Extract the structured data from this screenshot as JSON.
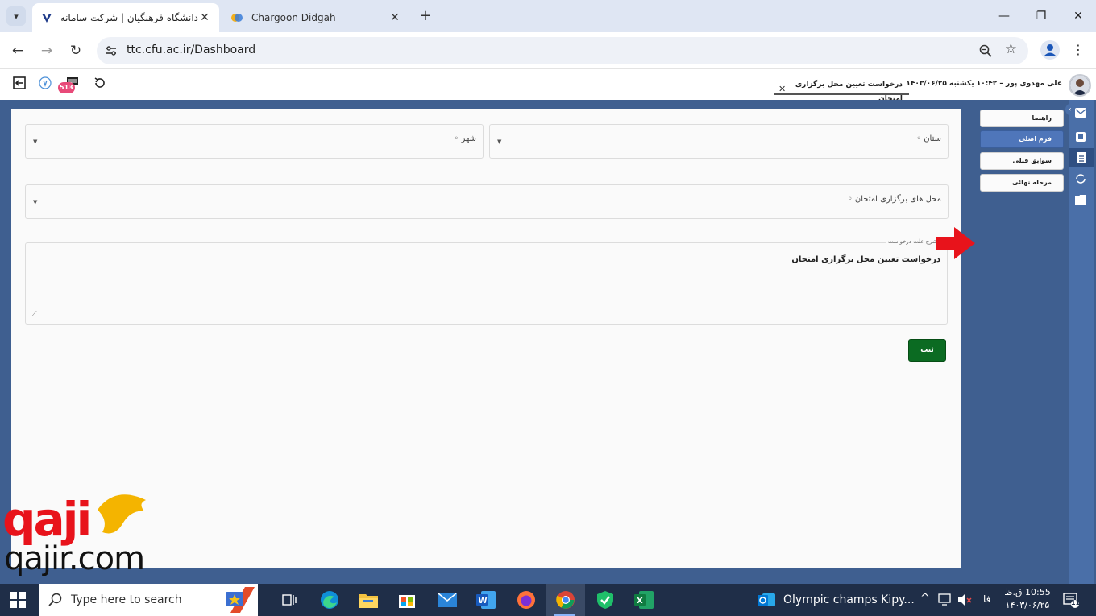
{
  "browser": {
    "tabs": [
      {
        "label": "دانشگاه فرهنگیان | شرکت سامانه",
        "active": true
      },
      {
        "label": "Chargoon Didgah",
        "active": false
      }
    ],
    "url": "ttc.cfu.ac.ir/Dashboard"
  },
  "app_header": {
    "notification_count": "513",
    "user_info": "علی مهدوی پور – ۱۰:۴۲ یکشنبه ۱۴۰۳/۰۶/۲۵",
    "open_tab_title": "درخواست تعیین محل برگزاری امتحان"
  },
  "form": {
    "province_label": "ستان ◦",
    "city_label": "شهر ◦",
    "exam_location_label": "محل های برگزاری امتحان ◦",
    "reason_legend": "شرح علت درخواست",
    "reason_value": "درخواست تعیین محل برگزاری امتحان",
    "submit_label": "ثبت"
  },
  "steps": [
    {
      "label": "راهنما",
      "active": false
    },
    {
      "label": "فرم اصلی",
      "active": true
    },
    {
      "label": "سوابق قبلی",
      "active": false
    },
    {
      "label": "مرحله نهائی",
      "active": false
    }
  ],
  "watermark": {
    "logo_text": "qaji",
    "site": "qajir.com"
  },
  "taskbar": {
    "search_placeholder": "Type here to search",
    "outlook_item": "Olympic champs Kipy...",
    "lang": "فا",
    "time": "10:55 ق.ظ",
    "date": "۱۴۰۳/۰۶/۲۵",
    "notif_count": "11"
  },
  "colors": {
    "workspace": "#3f5f90",
    "active_step": "#4f76ba",
    "submit": "#0b6b22",
    "arrow": "#e8131b",
    "badge": "#e84a79"
  }
}
